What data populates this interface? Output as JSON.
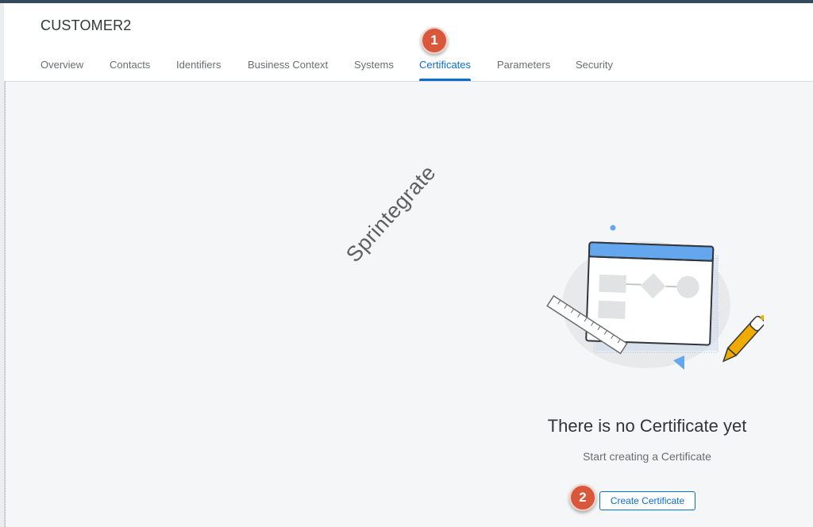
{
  "object": {
    "title": "CUSTOMER2"
  },
  "tabs": [
    {
      "label": "Overview"
    },
    {
      "label": "Contacts"
    },
    {
      "label": "Identifiers"
    },
    {
      "label": "Business Context"
    },
    {
      "label": "Systems"
    },
    {
      "label": "Certificates",
      "selected": true
    },
    {
      "label": "Parameters"
    },
    {
      "label": "Security"
    }
  ],
  "watermark": "Sprintegrate",
  "annotations": {
    "step1": "1",
    "step2": "2"
  },
  "empty_state": {
    "title": "There is no Certificate yet",
    "subtitle": "Start creating a Certificate",
    "create_label": "Create Certificate"
  },
  "colors": {
    "accent": "#0a6ed1",
    "badge": "#d9573b",
    "shell": "#354a5f"
  }
}
